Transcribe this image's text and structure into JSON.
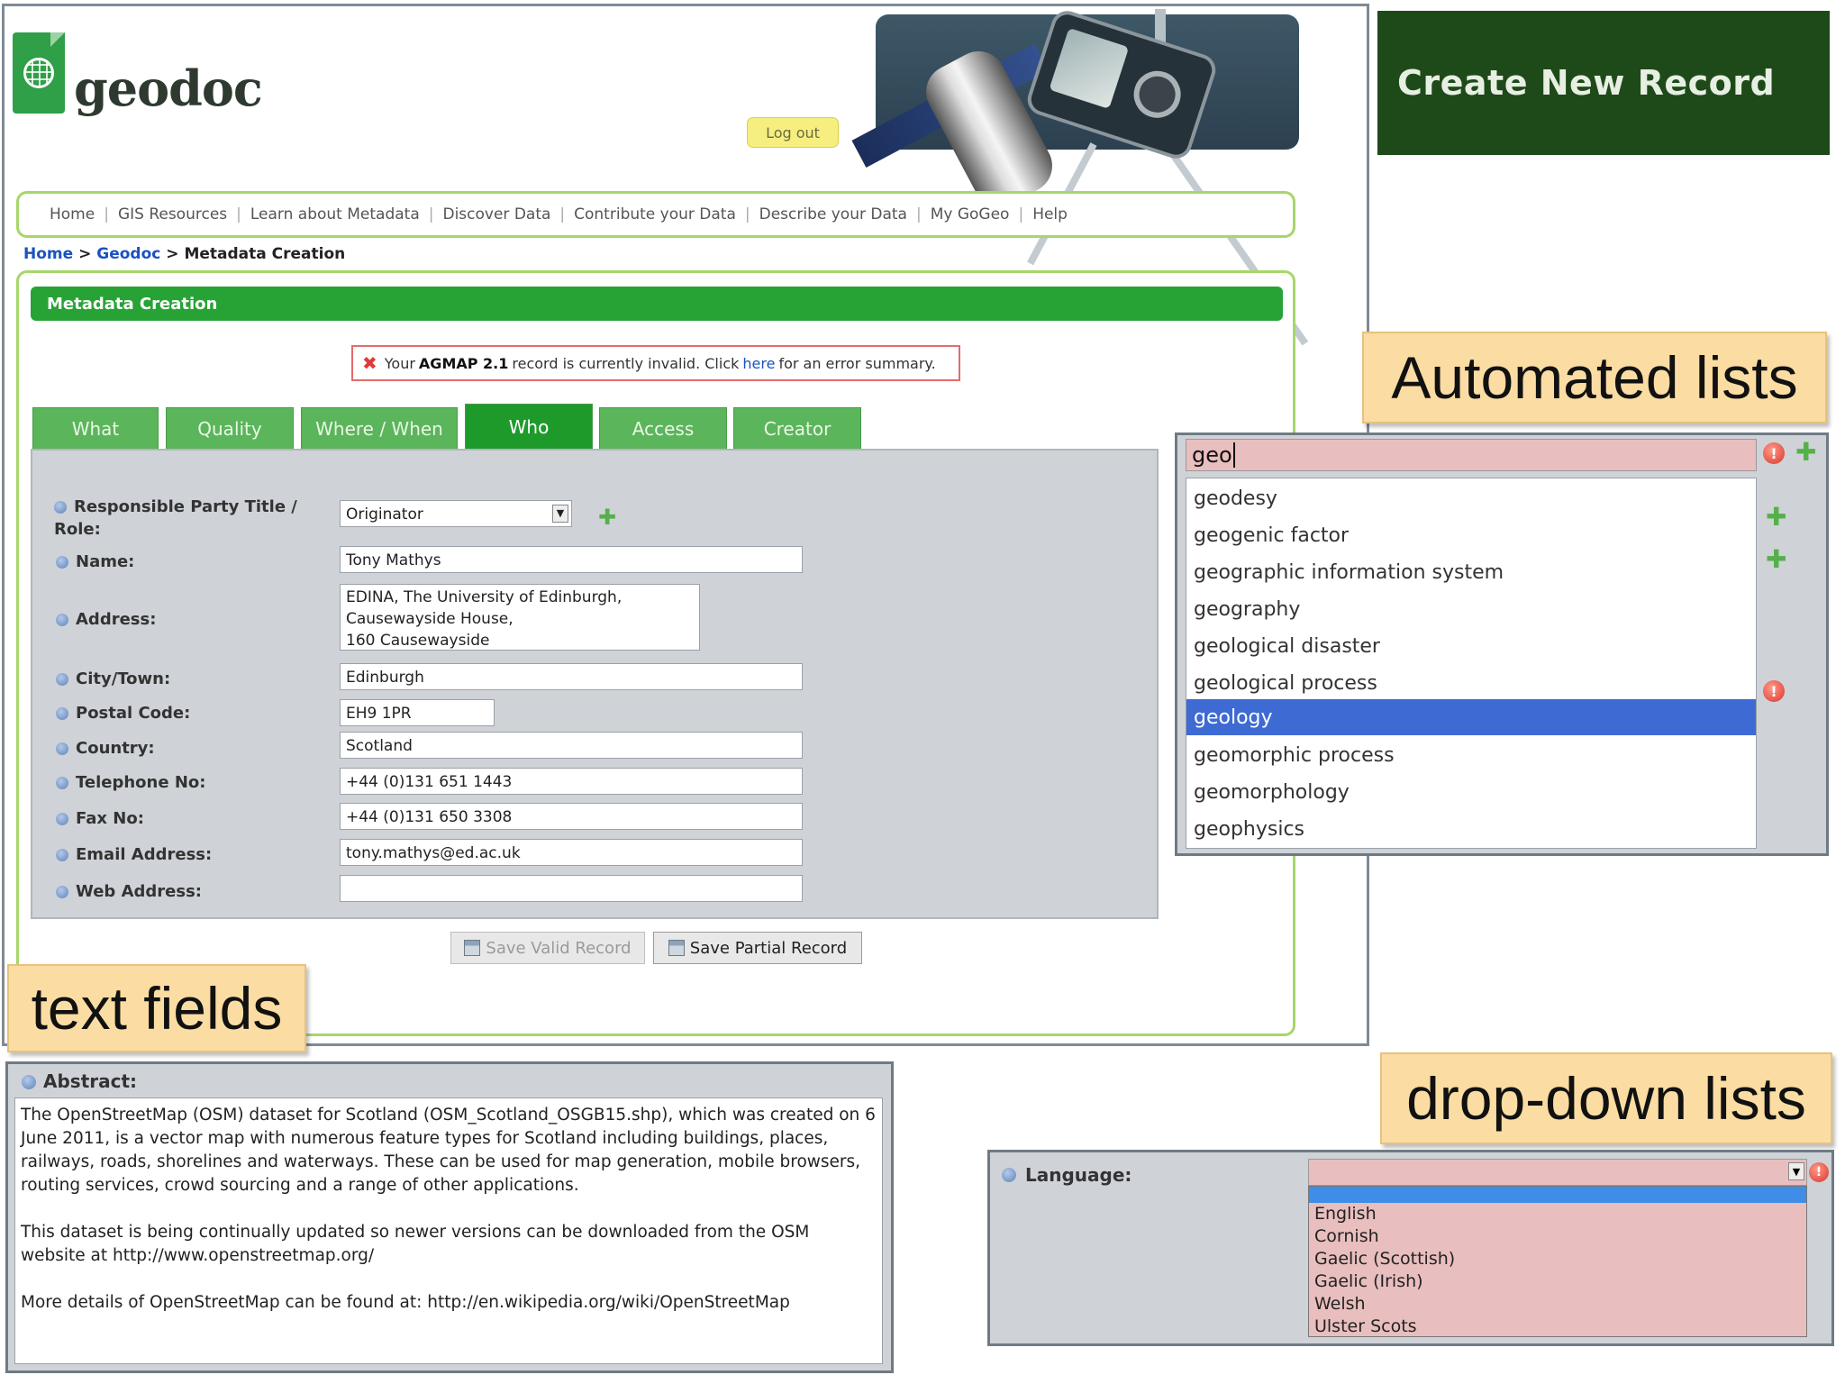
{
  "logo": {
    "text": "geodoc"
  },
  "header": {
    "logout_label": "Log out"
  },
  "nav": {
    "items": [
      "Home",
      "GIS Resources",
      "Learn about Metadata",
      "Discover Data",
      "Contribute your Data",
      "Describe your Data",
      "My GoGeo",
      "Help"
    ],
    "separator": "|"
  },
  "breadcrumb": {
    "home": "Home",
    "sep": ">",
    "geodoc": "Geodoc",
    "current": "Metadata Creation"
  },
  "section": {
    "title": "Metadata Creation"
  },
  "error_banner": {
    "prefix": "Your",
    "record_name": "AGMAP 2.1",
    "middle": "record is currently invalid. Click",
    "link": "here",
    "suffix": "for an error summary."
  },
  "tabs": [
    {
      "label": "What",
      "active": false
    },
    {
      "label": "Quality",
      "active": false
    },
    {
      "label": "Where / When",
      "active": false
    },
    {
      "label": "Who",
      "active": true
    },
    {
      "label": "Access",
      "active": false
    },
    {
      "label": "Creator",
      "active": false
    }
  ],
  "form": {
    "role_label": "Responsible Party Title /\nRole:",
    "role_value": "Originator",
    "name_label": "Name:",
    "name_value": "Tony Mathys",
    "address_label": "Address:",
    "address_value": "EDINA, The University of Edinburgh,\nCausewayside House,\n160 Causewayside",
    "city_label": "City/Town:",
    "city_value": "Edinburgh",
    "postal_label": "Postal Code:",
    "postal_value": "EH9 1PR",
    "country_label": "Country:",
    "country_value": "Scotland",
    "phone_label": "Telephone No:",
    "phone_value": "+44 (0)131 651 1443",
    "fax_label": "Fax No:",
    "fax_value": "+44 (0)131 650 3308",
    "email_label": "Email Address:",
    "email_value": "tony.mathys@ed.ac.uk",
    "web_label": "Web Address:",
    "web_value": ""
  },
  "buttons": {
    "save_valid": "Save Valid Record",
    "save_partial": "Save Partial Record"
  },
  "create_record": {
    "title": "Create New Record"
  },
  "callouts": {
    "automated": "Automated lists",
    "text_fields": "text fields",
    "dropdown": "drop-down lists"
  },
  "autocomplete": {
    "input_value": "geo",
    "items": [
      "geodesy",
      "geogenic factor",
      "geographic information system",
      "geography",
      "geological disaster",
      "geological process",
      "geology",
      "geomorphic process",
      "geomorphology",
      "geophysics"
    ],
    "selected_index": 6
  },
  "abstract": {
    "label": "Abstract:",
    "paragraphs": [
      "The OpenStreetMap (OSM) dataset for Scotland (OSM_Scotland_OSGB15.shp), which was created on 6 June 2011, is a vector map with numerous feature types for Scotland including buildings, places, railways, roads, shorelines and waterways. These can be used for map generation, mobile browsers, routing services, crowd sourcing and a range of other applications.",
      "This dataset is being continually updated so newer versions can be downloaded from the OSM website at http://www.openstreetmap.org/",
      "More details of OpenStreetMap can be found at: http://en.wikipedia.org/wiki/OpenStreetMap"
    ]
  },
  "language": {
    "label": "Language:",
    "options": [
      "English",
      "Cornish",
      "Gaelic (Scottish)",
      "Gaelic (Irish)",
      "Welsh",
      "Ulster Scots"
    ]
  },
  "colors": {
    "brand_green": "#27a336",
    "tab_active": "#1e9a2b",
    "invalid_field": "#e9bebe",
    "selection_blue": "#3e6ad4",
    "callout": "#fbdca3"
  }
}
